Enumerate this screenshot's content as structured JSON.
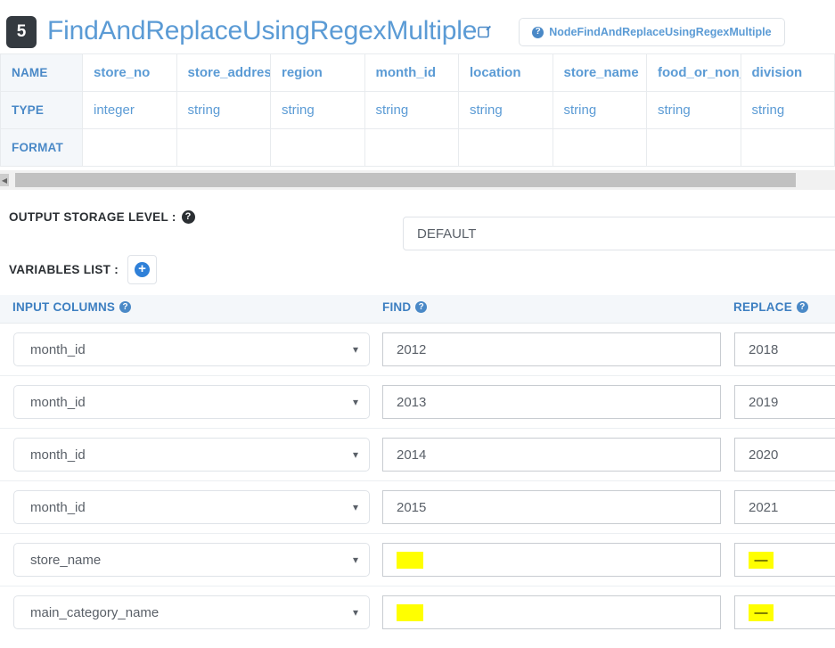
{
  "header": {
    "node_number": "5",
    "title": "FindAndReplaceUsingRegexMultiple",
    "edit_icon": "edit-square-icon",
    "doc_button_label": "NodeFindAndReplaceUsingRegexMultiple",
    "help_icon": "question-circle-icon"
  },
  "schema_table": {
    "row_labels": [
      "NAME",
      "TYPE",
      "FORMAT"
    ],
    "columns": [
      {
        "name": "store_no",
        "type": "integer",
        "format": ""
      },
      {
        "name": "store_address",
        "type": "string",
        "format": ""
      },
      {
        "name": "region",
        "type": "string",
        "format": ""
      },
      {
        "name": "month_id",
        "type": "string",
        "format": ""
      },
      {
        "name": "location",
        "type": "string",
        "format": ""
      },
      {
        "name": "store_name",
        "type": "string",
        "format": ""
      },
      {
        "name": "food_or_non_food",
        "type": "string",
        "format": ""
      },
      {
        "name": "division",
        "type": "string",
        "format": ""
      }
    ]
  },
  "scrollbar": {
    "left_arrow_icon": "chevron-left-icon",
    "orientation": "horizontal"
  },
  "output_storage": {
    "label": "OUTPUT STORAGE LEVEL :",
    "help_icon": "question-circle-icon",
    "value": "DEFAULT"
  },
  "variables_list": {
    "label": "VARIABLES LIST :",
    "add_icon": "plus-circle-icon"
  },
  "mapping": {
    "headers": {
      "input_columns": "INPUT COLUMNS",
      "find": "FIND",
      "replace": "REPLACE",
      "help_icon": "question-circle-icon"
    },
    "rows": [
      {
        "input_column": "month_id",
        "find": "2012",
        "replace": "2018",
        "find_redacted": false,
        "replace_redacted": false
      },
      {
        "input_column": "month_id",
        "find": "2013",
        "replace": "2019",
        "find_redacted": false,
        "replace_redacted": false
      },
      {
        "input_column": "month_id",
        "find": "2014",
        "replace": "2020",
        "find_redacted": false,
        "replace_redacted": false
      },
      {
        "input_column": "month_id",
        "find": "2015",
        "replace": "2021",
        "find_redacted": false,
        "replace_redacted": false
      },
      {
        "input_column": "store_name",
        "find": "",
        "replace": "—",
        "find_redacted": true,
        "replace_redacted": true
      },
      {
        "input_column": "main_category_name",
        "find": "",
        "replace": "—",
        "find_redacted": true,
        "replace_redacted": true
      }
    ],
    "dropdown_icon": "chevron-down-icon"
  },
  "colors": {
    "accent_blue": "#5b9bd5",
    "link_blue": "#4a89c7",
    "badge_dark": "#343a40",
    "header_band": "#f4f7fa",
    "redaction": "#ffff00"
  }
}
